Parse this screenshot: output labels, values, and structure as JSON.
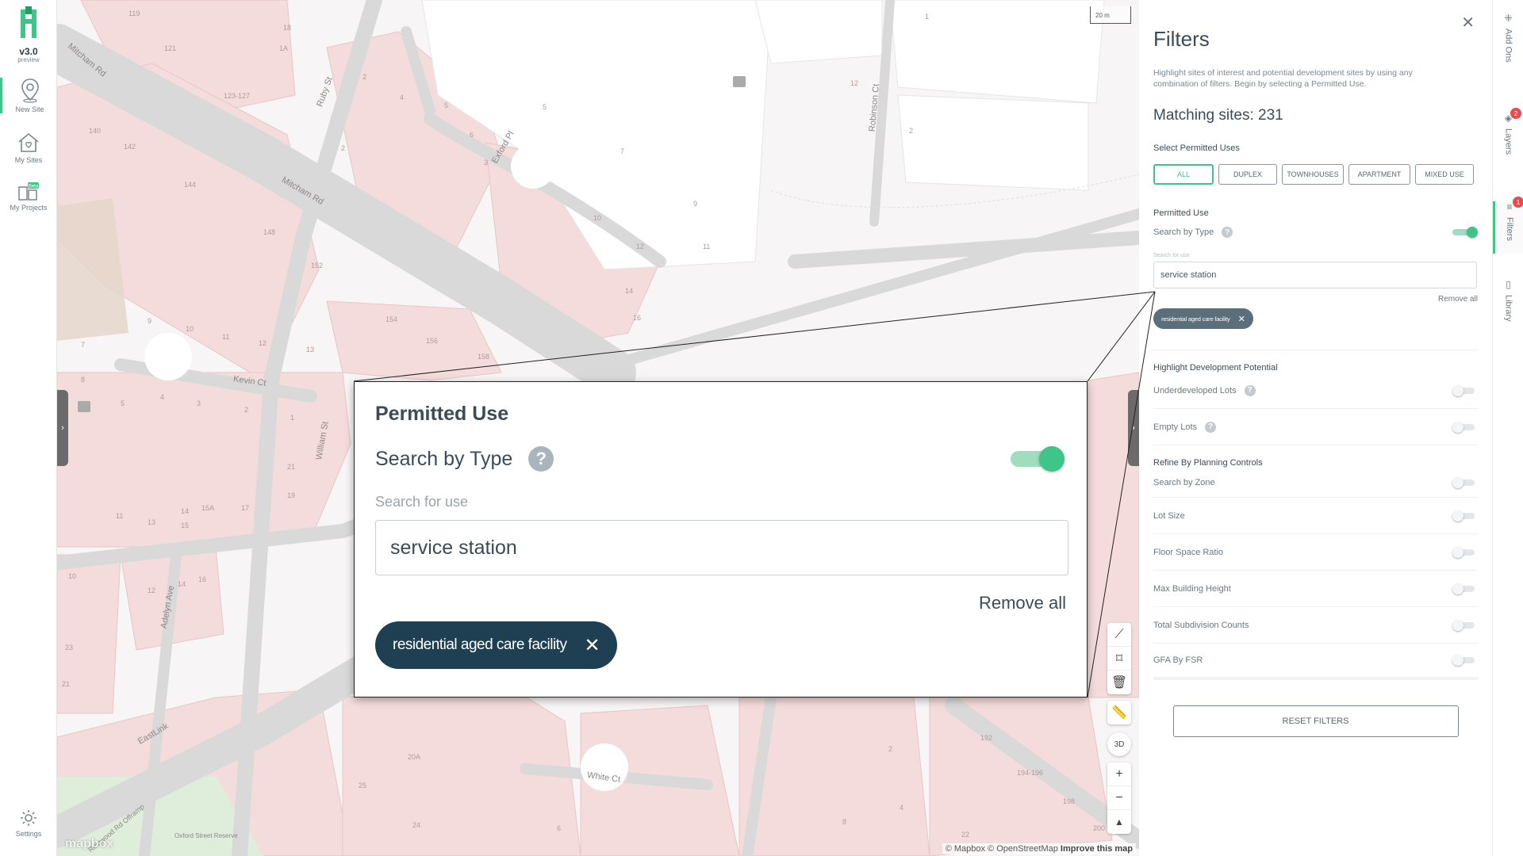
{
  "app": {
    "version": "v3.0",
    "version_sub": "preview"
  },
  "nav": {
    "new_site": "New Site",
    "my_sites": "My Sites",
    "my_projects": "My Projects",
    "beta_badge": "Beta",
    "settings": "Settings"
  },
  "map": {
    "scale": "20 m",
    "attribution": "© Mapbox © OpenStreetMap",
    "improve": "Improve this map",
    "mapbox_logo": "mapbox",
    "streets": {
      "mitcham_rd_1": "Mitcham Rd",
      "mitcham_rd_2": "Mitcham Rd",
      "ruby_st": "Ruby St",
      "exford_pl": "Exford Pl",
      "robinson_ct": "Robinson Ct",
      "kevin_ct": "Kevin Ct",
      "william_st": "William St",
      "adelyn_ave": "Adelyn Ave",
      "eastlink": "EastLink",
      "white_ct": "White Ct",
      "oxford_reserve": "Oxford Street Reserve",
      "offramp": "Ringwood Rd Offramp"
    },
    "lots": [
      "119",
      "18",
      "121",
      "1A",
      "123-127",
      "2",
      "4",
      "5",
      "6",
      "2",
      "3",
      "140",
      "142",
      "144",
      "148",
      "152",
      "154",
      "156",
      "158",
      "9",
      "10",
      "11",
      "12",
      "13",
      "5",
      "4",
      "3",
      "2",
      "1",
      "7",
      "8",
      "14",
      "15A",
      "17",
      "19",
      "21",
      "11",
      "13",
      "15",
      "10",
      "12",
      "14",
      "16",
      "23",
      "21",
      "1",
      "7",
      "5",
      "9",
      "11",
      "2",
      "12",
      "14",
      "16",
      "10",
      "12",
      "192",
      "194-196",
      "198",
      "200",
      "20A",
      "25",
      "24",
      "6",
      "2",
      "4",
      "22",
      "8"
    ]
  },
  "zoom": {
    "title": "Permitted Use",
    "search_by_type": "Search by Type",
    "help": "?",
    "search_hint": "Search for use",
    "search_value": "service station",
    "remove_all": "Remove all",
    "chip_label": "residential aged care facility",
    "chip_close": "✕"
  },
  "panel": {
    "title": "Filters",
    "close": "✕",
    "description": "Highlight sites of interest and potential development sites by using any combination of filters. Begin by selecting a Permitted Use.",
    "matching": "Matching sites: 231",
    "select_uses_label": "Select Permitted Uses",
    "uses": [
      "ALL",
      "DUPLEX",
      "TOWNHOUSES",
      "APARTMENT",
      "MIXED USE"
    ],
    "permitted_use_label": "Permitted Use",
    "search_by_type": "Search by Type",
    "search_hint": "Search for use",
    "search_value": "service station",
    "remove_all": "Remove all",
    "chip_label": "residential aged care facility",
    "chip_close": "✕",
    "highlight_label": "Highlight Development Potential",
    "underdeveloped": "Underdeveloped Lots",
    "empty_lots": "Empty Lots",
    "refine_label": "Refine By Planning Controls",
    "refine_items": [
      "Search by Zone",
      "Lot Size",
      "Floor Space Ratio",
      "Max Building Height",
      "Total Subdivision Counts",
      "GFA By FSR"
    ],
    "reset": "RESET FILTERS"
  },
  "tabs": {
    "add_ons": "Add Ons",
    "layers": "Layers",
    "layers_badge": "2",
    "filters": "Filters",
    "filters_badge": "1",
    "library": "Library"
  },
  "colors": {
    "accent": "#3fc48a",
    "chip_dark": "#1f3f52",
    "lot_fill": "#f4dcdc",
    "road": "#dcdcdc"
  }
}
